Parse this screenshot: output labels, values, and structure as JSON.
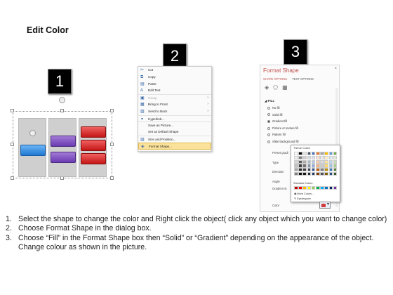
{
  "title": "Edit Color",
  "badges": [
    "1",
    "2",
    "3"
  ],
  "context_menu": {
    "items": [
      {
        "label": "Cut",
        "icon": "scissors-icon",
        "glyph": "✂",
        "disabled": false
      },
      {
        "label": "Copy",
        "icon": "copy-icon",
        "glyph": "⧉",
        "disabled": false
      },
      {
        "label": "Paste",
        "icon": "paste-icon",
        "glyph": "▤",
        "disabled": false
      },
      {
        "label": "Edit Text",
        "icon": "edit-text-icon",
        "glyph": "A",
        "disabled": false
      },
      {
        "label": "Group",
        "icon": "group-icon",
        "glyph": "▣",
        "disabled": true,
        "submenu": true
      },
      {
        "label": "Bring to Front",
        "icon": "bring-front-icon",
        "glyph": "▦",
        "disabled": false,
        "submenu": true
      },
      {
        "label": "Send to Back",
        "icon": "send-back-icon",
        "glyph": "▧",
        "disabled": false,
        "submenu": true
      },
      {
        "label": "Hyperlink...",
        "icon": "hyperlink-icon",
        "glyph": "⚭",
        "disabled": false
      },
      {
        "label": "Save as Picture...",
        "icon": "",
        "glyph": "",
        "disabled": false
      },
      {
        "label": "Set as Default Shape",
        "icon": "",
        "glyph": "",
        "disabled": false
      },
      {
        "label": "Size and Position...",
        "icon": "size-position-icon",
        "glyph": "▥",
        "disabled": false
      },
      {
        "label": "Format Shape...",
        "icon": "format-shape-icon",
        "glyph": "◈",
        "disabled": false,
        "highlighted": true
      }
    ]
  },
  "format_pane": {
    "title": "Format Shape",
    "close": "×",
    "tabs": [
      "SHAPE OPTIONS",
      "TEXT OPTIONS"
    ],
    "icons": [
      "◈",
      "⬠",
      "▦"
    ],
    "fill_header": "◢ FILL",
    "options": [
      "No fill",
      "Solid fill",
      "Gradient fill",
      "Picture or texture fill",
      "Pattern fill",
      "Slide background fill"
    ],
    "selected_option": 2,
    "labels": [
      "Preset gradi",
      "Type",
      "Direction",
      "Angle",
      "Gradient st",
      "Color"
    ]
  },
  "palette": {
    "theme_label": "Theme Colors",
    "standard_label": "Standard Colors",
    "more_colors": "More Colors...",
    "eyedropper": "Eyedropper",
    "theme_top": [
      "#ffffff",
      "#000000",
      "#e7e6e6",
      "#44546a",
      "#4472c4",
      "#ed7d31",
      "#a5a5a5",
      "#ffc000",
      "#5b9bd5",
      "#70ad47"
    ],
    "theme_shades": [
      [
        "#f2f2f2",
        "#7f7f7f",
        "#d0cece",
        "#d6dce4",
        "#d9e2f3",
        "#fbe5d5",
        "#ededed",
        "#fff2cc",
        "#deebf6",
        "#e2efd9"
      ],
      [
        "#d8d8d8",
        "#595959",
        "#aeabab",
        "#adb9ca",
        "#b4c6e7",
        "#f7cbac",
        "#dbdbdb",
        "#fee599",
        "#bdd7ee",
        "#c5e0b3"
      ],
      [
        "#bfbfbf",
        "#3f3f3f",
        "#757070",
        "#8496b0",
        "#8eaadb",
        "#f4b183",
        "#c9c9c9",
        "#ffd965",
        "#9cc3e5",
        "#a8d08d"
      ],
      [
        "#a5a5a5",
        "#262626",
        "#3a3838",
        "#333f4f",
        "#2f5496",
        "#c55a11",
        "#7b7b7b",
        "#bf9000",
        "#2e75b5",
        "#538135"
      ],
      [
        "#7f7f7f",
        "#0c0c0c",
        "#171616",
        "#222a35",
        "#1f3864",
        "#833c0b",
        "#525252",
        "#7f6000",
        "#1e4e79",
        "#375623"
      ]
    ],
    "standard": [
      "#c00000",
      "#ff0000",
      "#ffc000",
      "#ffff00",
      "#92d050",
      "#00b050",
      "#00b0f0",
      "#0070c0",
      "#002060",
      "#7030a0"
    ]
  },
  "instructions": [
    {
      "num": "1.",
      "text": "Select the shape to change the color and Right click the object( click any object which you want to change color)"
    },
    {
      "num": "2.",
      "text": "Choose Format Shape in the dialog box."
    },
    {
      "num": "3.",
      "text": "Choose “Fill” in the Format Shape box then “Solid” or “Gradient” depending on the appearance of the object. Change colour as shown in the picture."
    }
  ]
}
